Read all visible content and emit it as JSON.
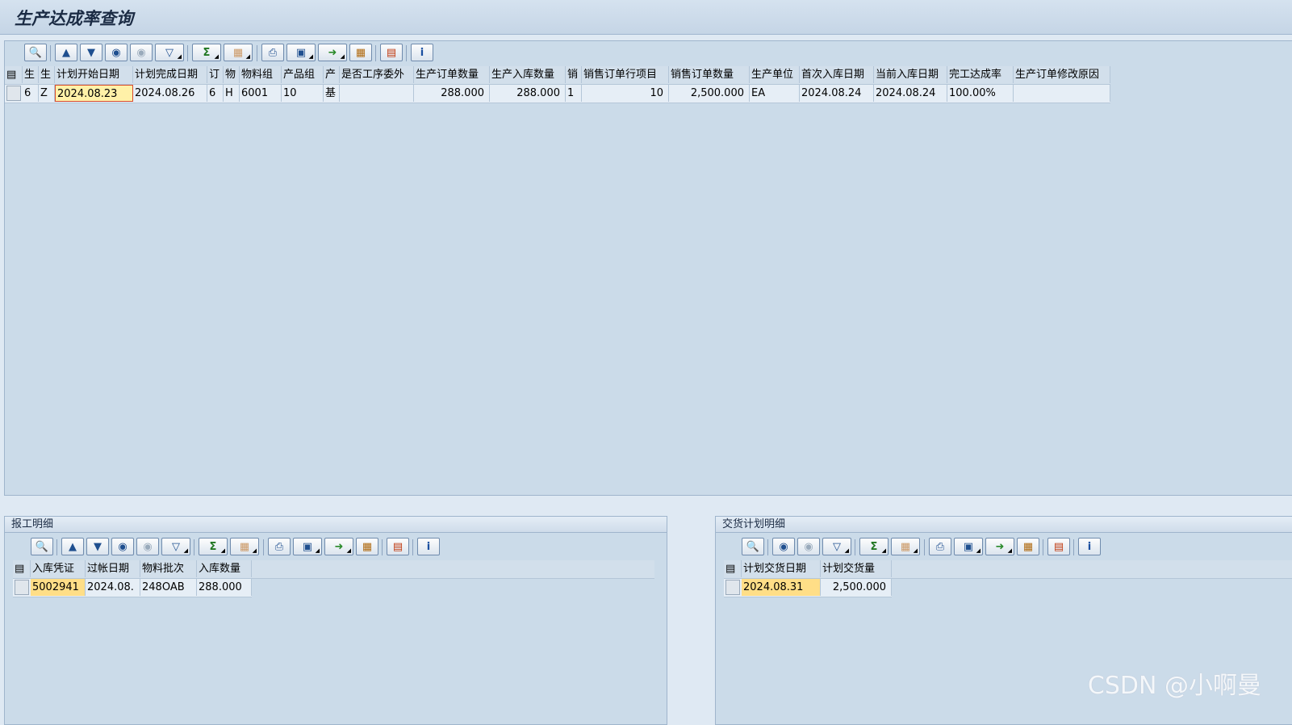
{
  "app": {
    "title": "生产达成率查询"
  },
  "main_table": {
    "columns": [
      "生",
      "生",
      "计划开始日期",
      "计划完成日期",
      "订",
      "物",
      "物料组",
      "产品组",
      "产",
      "是否工序委外",
      "生产订单数量",
      "生产入库数量",
      "销",
      "销售订单行项目",
      "销售订单数量",
      "生产单位",
      "首次入库日期",
      "当前入库日期",
      "完工达成率",
      "生产订单修改原因"
    ],
    "rows": [
      [
        "6",
        "Z",
        "2024.08.23",
        "2024.08.26",
        "6",
        "H",
        "6001",
        "10",
        "基",
        "",
        "288.000",
        "288.000",
        "1",
        "10",
        "2,500.000",
        "EA",
        "2024.08.24",
        "2024.08.24",
        "100.00%",
        ""
      ]
    ]
  },
  "report_panel": {
    "title": "报工明细",
    "columns": [
      "入库凭证",
      "过帐日期",
      "物料批次",
      "入库数量"
    ],
    "rows": [
      [
        "5002941",
        "2024.08.",
        "248OAB",
        "288.000"
      ]
    ]
  },
  "delivery_panel": {
    "title": "交货计划明细",
    "columns": [
      "计划交货日期",
      "计划交货量"
    ],
    "rows": [
      [
        "2024.08.31",
        "2,500.000"
      ]
    ]
  },
  "toolbar_icons": [
    "details-icon",
    "sort-ascending-icon",
    "sort-descending-icon",
    "find-icon",
    "find-next-icon",
    "filter-icon",
    "sum-icon",
    "subtotal-icon",
    "print-icon",
    "views-icon",
    "export-icon",
    "layout-icon",
    "graphic-icon",
    "info-icon"
  ],
  "watermark": "CSDN @小啊曼",
  "colors": {
    "background": "#dfe9f3",
    "panel": "#cbdbe9",
    "highlight": "#ffde87"
  }
}
